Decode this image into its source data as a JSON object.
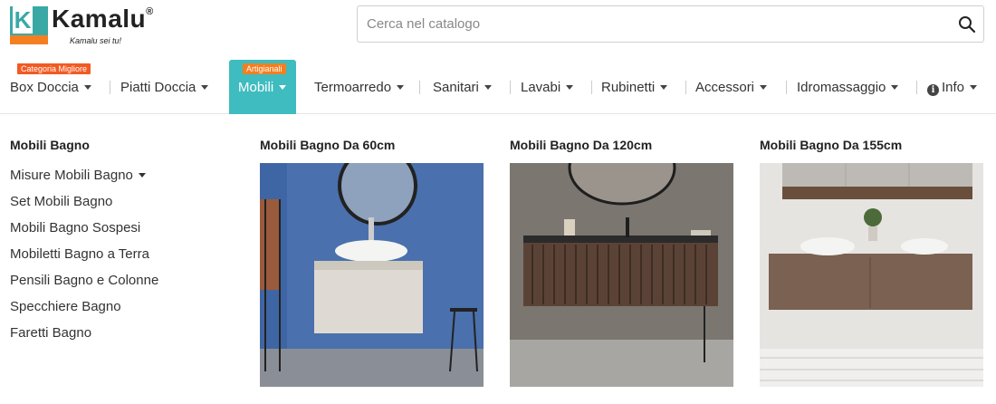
{
  "brand": {
    "name": "Kamalu",
    "reg": "®",
    "letter": "K",
    "tagline": "Kamalu sei tu!"
  },
  "search": {
    "placeholder": "Cerca nel catalogo",
    "icon": "search-icon"
  },
  "nav": {
    "items": [
      {
        "label": "Box Doccia",
        "badge": "Categoria Migliore"
      },
      {
        "label": "Piatti Doccia"
      },
      {
        "label": "Mobili",
        "badge": "Artigianali",
        "active": true
      },
      {
        "label": "Termoarredo"
      },
      {
        "label": "Sanitari"
      },
      {
        "label": "Lavabi"
      },
      {
        "label": "Rubinetti"
      },
      {
        "label": "Accessori"
      },
      {
        "label": "Idromassaggio"
      },
      {
        "label": "Info",
        "icon": "info-icon"
      }
    ]
  },
  "megamenu": {
    "title": "Mobili Bagno",
    "items": [
      "Misure Mobili Bagno",
      "Set Mobili Bagno",
      "Mobili Bagno Sospesi",
      "Mobiletti Bagno a Terra",
      "Pensili Bagno e Colonne",
      "Specchiere Bagno",
      "Faretti Bagno"
    ],
    "products": [
      {
        "title": "Mobili Bagno Da 60cm"
      },
      {
        "title": "Mobili Bagno Da 120cm"
      },
      {
        "title": "Mobili Bagno Da 155cm"
      }
    ]
  },
  "colors": {
    "accent": "#3fbcbf",
    "badge": "#f15a22",
    "logo_teal": "#3aa9a6",
    "logo_orange": "#f47f20"
  }
}
